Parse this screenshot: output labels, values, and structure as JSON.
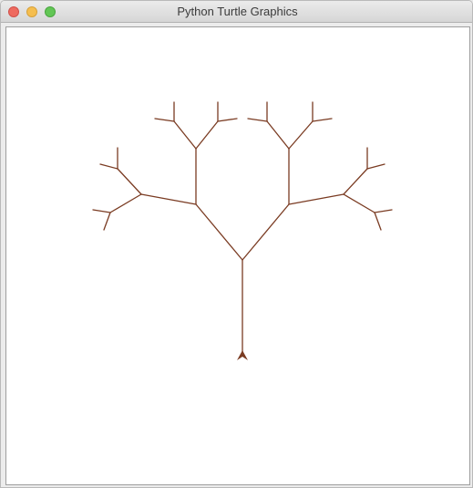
{
  "window": {
    "title": "Python Turtle Graphics"
  },
  "controls": {
    "close": "close-button",
    "minimize": "minimize-button",
    "zoom": "zoom-button"
  },
  "canvas": {
    "background": "#ffffff",
    "pen_color": "#7a3b22",
    "turtle_shape": "classic-arrow",
    "turtle_heading": "up",
    "drawing": "fractal-tree"
  }
}
